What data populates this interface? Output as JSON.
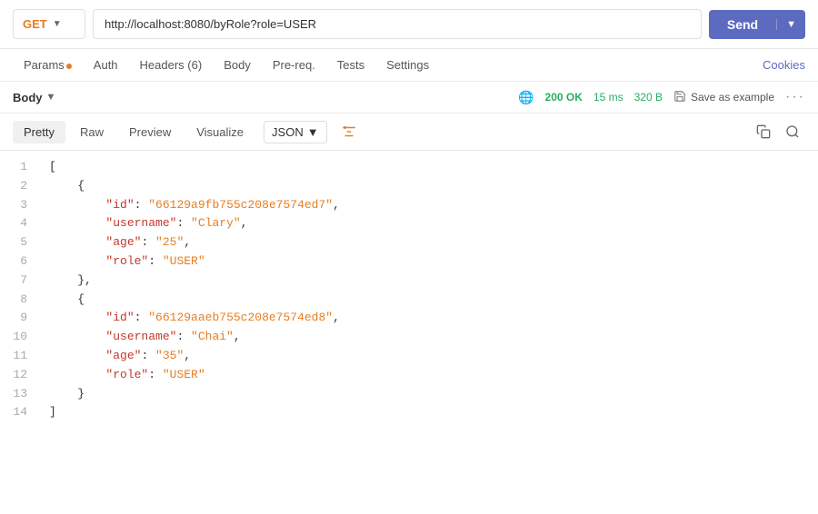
{
  "urlBar": {
    "method": "GET",
    "url": "http://localhost:8080/byRole?role=USER",
    "sendLabel": "Send"
  },
  "tabs": [
    {
      "id": "params",
      "label": "Params",
      "hasDot": true
    },
    {
      "id": "auth",
      "label": "Auth",
      "hasDot": false
    },
    {
      "id": "headers",
      "label": "Headers (6)",
      "hasDot": false
    },
    {
      "id": "body",
      "label": "Body",
      "hasDot": false
    },
    {
      "id": "prereq",
      "label": "Pre-req.",
      "hasDot": false
    },
    {
      "id": "tests",
      "label": "Tests",
      "hasDot": false
    },
    {
      "id": "settings",
      "label": "Settings",
      "hasDot": false
    }
  ],
  "cookiesLabel": "Cookies",
  "bodySection": {
    "label": "Body",
    "status": "200 OK",
    "time": "15 ms",
    "size": "320 B",
    "saveExample": "Save as example"
  },
  "viewTabs": [
    "Pretty",
    "Raw",
    "Preview",
    "Visualize"
  ],
  "activeViewTab": "Pretty",
  "format": "JSON",
  "codeLines": [
    {
      "num": 1,
      "text": "[",
      "tokens": [
        {
          "type": "bracket",
          "val": "["
        }
      ]
    },
    {
      "num": 2,
      "text": "    {",
      "tokens": [
        {
          "type": "bracket",
          "val": "    {"
        }
      ]
    },
    {
      "num": 3,
      "text": "        \"id\": \"66129a9fb755c208e7574ed7\",",
      "tokens": [
        {
          "type": "indent",
          "val": "        "
        },
        {
          "type": "key",
          "val": "\"id\""
        },
        {
          "type": "colon",
          "val": ": "
        },
        {
          "type": "string",
          "val": "\"66129a9fb755c208e7574ed7\""
        },
        {
          "type": "comma",
          "val": ","
        }
      ]
    },
    {
      "num": 4,
      "text": "        \"username\": \"Clary\",",
      "tokens": [
        {
          "type": "indent",
          "val": "        "
        },
        {
          "type": "key",
          "val": "\"username\""
        },
        {
          "type": "colon",
          "val": ": "
        },
        {
          "type": "string",
          "val": "\"Clary\""
        },
        {
          "type": "comma",
          "val": ","
        }
      ]
    },
    {
      "num": 5,
      "text": "        \"age\": \"25\",",
      "tokens": [
        {
          "type": "indent",
          "val": "        "
        },
        {
          "type": "key",
          "val": "\"age\""
        },
        {
          "type": "colon",
          "val": ": "
        },
        {
          "type": "string",
          "val": "\"25\""
        },
        {
          "type": "comma",
          "val": ","
        }
      ]
    },
    {
      "num": 6,
      "text": "        \"role\": \"USER\"",
      "tokens": [
        {
          "type": "indent",
          "val": "        "
        },
        {
          "type": "key",
          "val": "\"role\""
        },
        {
          "type": "colon",
          "val": ": "
        },
        {
          "type": "string",
          "val": "\"USER\""
        }
      ]
    },
    {
      "num": 7,
      "text": "    },",
      "tokens": [
        {
          "type": "bracket",
          "val": "    }"
        },
        {
          "type": "comma",
          "val": ","
        }
      ]
    },
    {
      "num": 8,
      "text": "    {",
      "tokens": [
        {
          "type": "bracket",
          "val": "    {"
        }
      ]
    },
    {
      "num": 9,
      "text": "        \"id\": \"66129aaeb755c208e7574ed8\",",
      "tokens": [
        {
          "type": "indent",
          "val": "        "
        },
        {
          "type": "key",
          "val": "\"id\""
        },
        {
          "type": "colon",
          "val": ": "
        },
        {
          "type": "string",
          "val": "\"66129aaeb755c208e7574ed8\""
        },
        {
          "type": "comma",
          "val": ","
        }
      ]
    },
    {
      "num": 10,
      "text": "        \"username\": \"Chai\",",
      "tokens": [
        {
          "type": "indent",
          "val": "        "
        },
        {
          "type": "key",
          "val": "\"username\""
        },
        {
          "type": "colon",
          "val": ": "
        },
        {
          "type": "string",
          "val": "\"Chai\""
        },
        {
          "type": "comma",
          "val": ","
        }
      ]
    },
    {
      "num": 11,
      "text": "        \"age\": \"35\",",
      "tokens": [
        {
          "type": "indent",
          "val": "        "
        },
        {
          "type": "key",
          "val": "\"age\""
        },
        {
          "type": "colon",
          "val": ": "
        },
        {
          "type": "string",
          "val": "\"35\""
        },
        {
          "type": "comma",
          "val": ","
        }
      ]
    },
    {
      "num": 12,
      "text": "        \"role\": \"USER\"",
      "tokens": [
        {
          "type": "indent",
          "val": "        "
        },
        {
          "type": "key",
          "val": "\"role\""
        },
        {
          "type": "colon",
          "val": ": "
        },
        {
          "type": "string",
          "val": "\"USER\""
        }
      ]
    },
    {
      "num": 13,
      "text": "    }",
      "tokens": [
        {
          "type": "bracket",
          "val": "    }"
        }
      ]
    },
    {
      "num": 14,
      "text": "]",
      "tokens": [
        {
          "type": "bracket",
          "val": "]"
        }
      ]
    }
  ]
}
